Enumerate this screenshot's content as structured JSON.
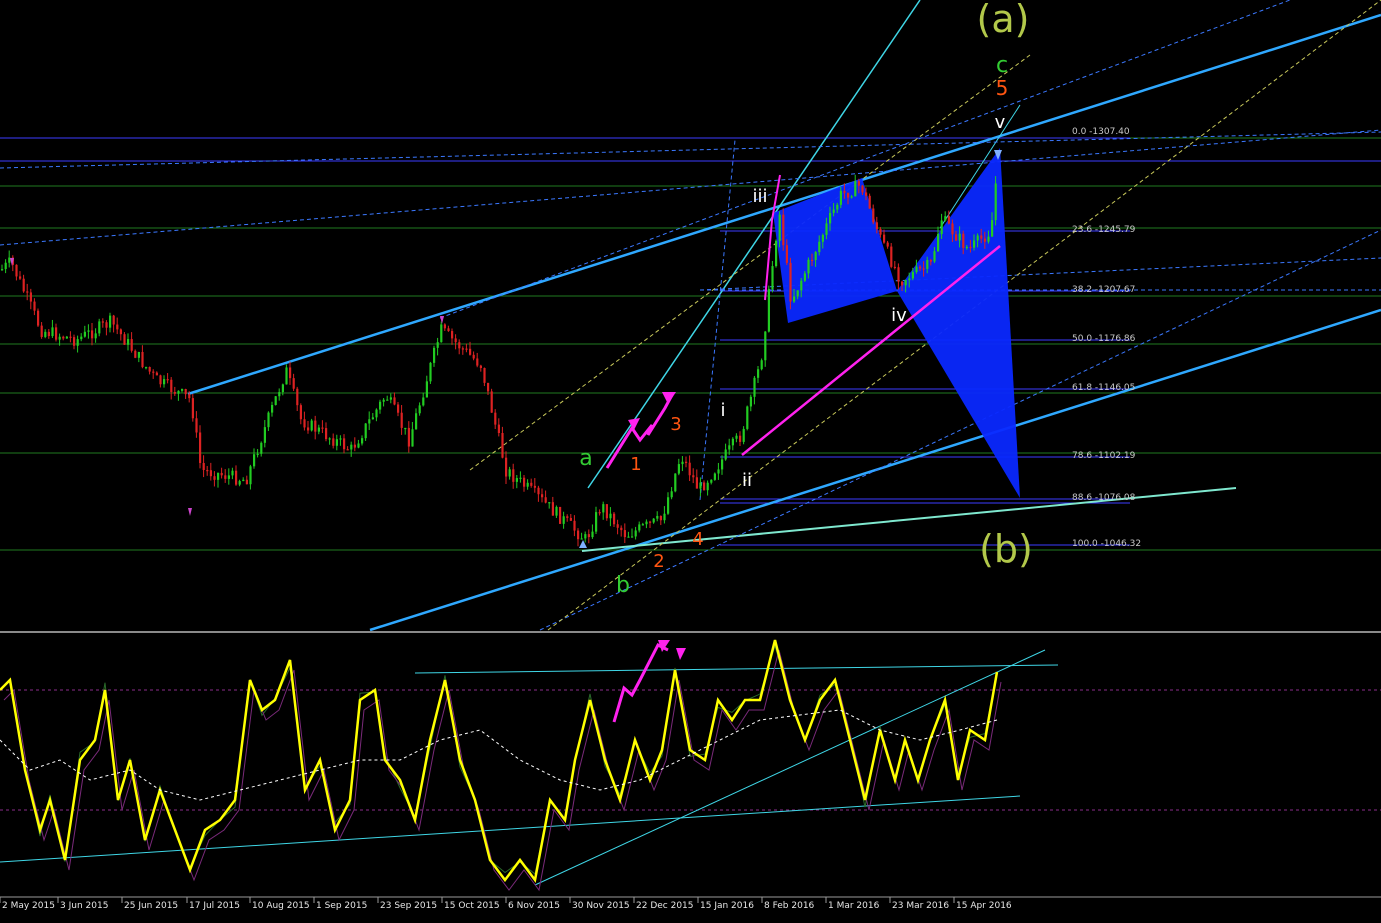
{
  "colors": {
    "background": "#000000",
    "bull_candle": "#22cc22",
    "bear_candle": "#dd2222",
    "fib_line": "#3b3bff",
    "fib_grid_green": "#1f7a1f",
    "channel_line": "#2fa8ff",
    "cyan_line": "#3fd6e6",
    "magenta": "#ff22ee",
    "pattern_fill": "#0a28ff",
    "osc_yellow": "#ffff00",
    "wave_green": "#33cc33",
    "wave_orange": "#ff5511",
    "wave_white": "#ffffff",
    "wave_olive": "#b2c84a"
  },
  "fib_levels": [
    {
      "label": "0.0 -1307.40"
    },
    {
      "label": "23.6 -1245.79"
    },
    {
      "label": "38.2 -1207.67"
    },
    {
      "label": "50.0 -1176.86"
    },
    {
      "label": "61.8 -1146.05"
    },
    {
      "label": "78.6 -1102.19"
    },
    {
      "label": "88.6 -1076.08"
    },
    {
      "label": "100.0 -1046.32"
    }
  ],
  "wave_labels": {
    "a_big": "(a)",
    "b_big": "(b)",
    "c": "c",
    "five": "5",
    "v": "v",
    "iii": "iii",
    "iv": "iv",
    "i": "i",
    "ii": "ii",
    "a": "a",
    "b": "b",
    "one": "1",
    "two": "2",
    "three": "3",
    "four": "4"
  },
  "date_axis": [
    "2 May 2015",
    "3 Jun 2015",
    "25 Jun 2015",
    "17 Jul 2015",
    "10 Aug 2015",
    "1 Sep 2015",
    "23 Sep 2015",
    "15 Oct 2015",
    "6 Nov 2015",
    "30 Nov 2015",
    "22 Dec 2015",
    "15 Jan 2016",
    "8 Feb 2016",
    "1 Mar 2016",
    "23 Mar 2016",
    "15 Apr 2016"
  ]
}
